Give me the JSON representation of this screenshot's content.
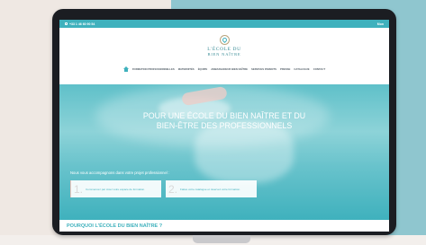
{
  "topbar": {
    "phone": "+33 1 46 60 90 54",
    "right": "Mon"
  },
  "brand": {
    "line1": "L'ÉCOLE DU",
    "line2": "BIEN NAÎTRE"
  },
  "nav": {
    "items": [
      "FORMATION PROFESSIONNELLES",
      "MATERNITÉS",
      "ÉQUIPE",
      "AMBASSADEUR BIEN NAÎTRE",
      "SERVICES PARENTS",
      "PRESSE",
      "CATALOGUE",
      "CONTACT"
    ]
  },
  "hero": {
    "title_line1": "POUR UNE ÉCOLE DU BIEN NAÎTRE ET DU",
    "title_line2": "BIEN-ÊTRE DES PROFESSIONNELS",
    "subtitle": "Nous vous accompagnons dans votre projet professionnel :",
    "cards": [
      {
        "num": "1.",
        "text": "Commencez par créer votre espace de formation."
      },
      {
        "num": "2.",
        "text": "Faites votre catalogue et réservez votre formation."
      }
    ]
  },
  "section": {
    "title": "POURQUOI L'ÉCOLE DU BIEN NAÎTRE ?"
  },
  "colors": {
    "accent": "#3fb1bd",
    "gold": "#b9a47c",
    "background_right": "#8fc6cf"
  },
  "icons": [
    "phone-icon",
    "home-icon",
    "logo-icon"
  ]
}
